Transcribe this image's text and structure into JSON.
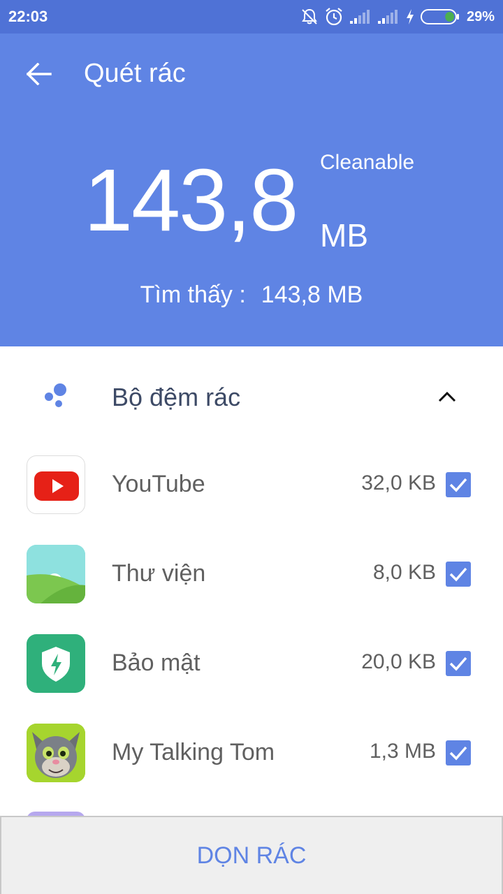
{
  "status_bar": {
    "time": "22:03",
    "battery_percent": "29%",
    "battery_level": 0.29,
    "icons": [
      "notifications-off-icon",
      "alarm-icon",
      "signal-icon",
      "signal-icon",
      "charging-icon",
      "battery-icon"
    ]
  },
  "header": {
    "title": "Quét rác",
    "back_icon": "arrow-left-icon",
    "junk_size": "143,8",
    "junk_unit": "MB",
    "cleanable_label": "Cleanable",
    "found_label": "Tìm thấy :",
    "found_value": "143,8 MB"
  },
  "section": {
    "title": "Bộ đệm rác",
    "icon": "dots-icon",
    "expand_icon": "chevron-up-icon"
  },
  "apps": [
    {
      "name": "YouTube",
      "size": "32,0 KB",
      "checked": true,
      "icon": "youtube-icon"
    },
    {
      "name": "Thư viện",
      "size": "8,0 KB",
      "checked": true,
      "icon": "gallery-icon"
    },
    {
      "name": "Bảo mật",
      "size": "20,0 KB",
      "checked": true,
      "icon": "security-icon"
    },
    {
      "name": "My Talking Tom",
      "size": "1,3 MB",
      "checked": true,
      "icon": "talking-tom-icon"
    }
  ],
  "bottom": {
    "clean_button_label": "DỌN RÁC"
  },
  "colors": {
    "header_bg": "#5f84e4",
    "status_bg": "#4f72d6",
    "accent": "#5f84e4"
  }
}
